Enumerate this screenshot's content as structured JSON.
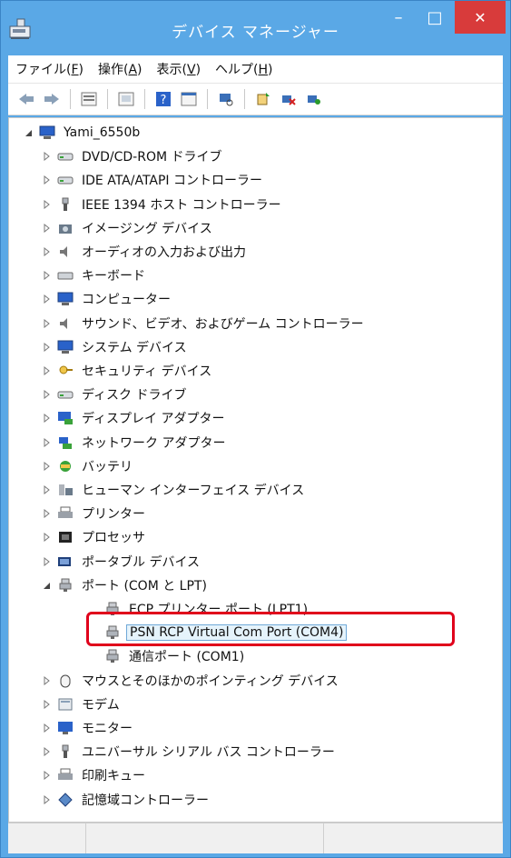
{
  "window": {
    "title": "デバイス マネージャー",
    "icon": "device-manager-icon",
    "controls": {
      "minimize": "–",
      "maximize": "□",
      "close": "✕"
    }
  },
  "menu": [
    {
      "label": "ファイル(",
      "key": "F",
      "suffix": ")"
    },
    {
      "label": "操作(",
      "key": "A",
      "suffix": ")"
    },
    {
      "label": "表示(",
      "key": "V",
      "suffix": ")"
    },
    {
      "label": "ヘルプ(",
      "key": "H",
      "suffix": ")"
    }
  ],
  "toolbar": {
    "buttons": [
      "back-icon",
      "forward-icon",
      "properties-icon",
      "refresh-icon",
      "help-icon",
      "console-icon",
      "scan-hardware-icon",
      "update-driver-icon",
      "uninstall-icon",
      "enable-device-icon"
    ]
  },
  "tree": {
    "root": "Yami_6550b",
    "categories": [
      "DVD/CD-ROM ドライブ",
      "IDE ATA/ATAPI コントローラー",
      "IEEE 1394 ホスト コントローラー",
      "イメージング デバイス",
      "オーディオの入力および出力",
      "キーボード",
      "コンピューター",
      "サウンド、ビデオ、およびゲーム コントローラー",
      "システム デバイス",
      "セキュリティ デバイス",
      "ディスク ドライブ",
      "ディスプレイ アダプター",
      "ネットワーク アダプター",
      "バッテリ",
      "ヒューマン インターフェイス デバイス",
      "プリンター",
      "プロセッサ",
      "ポータブル デバイス"
    ],
    "ports": {
      "label": "ポート (COM と LPT)",
      "children": [
        "ECP プリンター ポート (LPT1)",
        "PSN RCP Virtual Com Port (COM4)",
        "通信ポート (COM1)"
      ],
      "selected_index": 1
    },
    "after_ports": [
      "マウスとそのほかのポインティング デバイス",
      "モデム",
      "モニター",
      "ユニバーサル シリアル バス コントローラー",
      "印刷キュー",
      "記憶域コントローラー"
    ]
  },
  "colors": {
    "titlebar": "#5aa8e6",
    "close": "#d83b3b",
    "highlight": "#e0001b",
    "selection_bg": "#e5f3fb"
  }
}
